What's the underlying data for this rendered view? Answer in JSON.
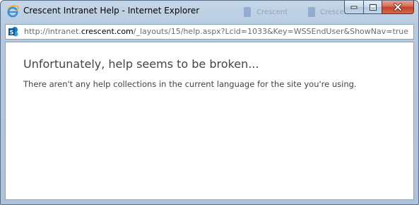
{
  "window": {
    "title": "Crescent Intranet Help - Internet Explorer",
    "background_items": [
      "Crescent Intranet",
      "Crescen"
    ]
  },
  "address_bar": {
    "url_prefix": "http://intranet.",
    "url_host": "crescent.com",
    "url_suffix": "/_layouts/15/help.aspx?Lcid=1033&Key=WSSEndUser&ShowNav=true",
    "site_icon": "sharepoint-icon"
  },
  "caption_buttons": [
    "minimize",
    "maximize",
    "close"
  ],
  "help": {
    "heading": "Unfortunately, help seems to be broken...",
    "message": "There aren't any help collections in the current language for the site you're using."
  },
  "colors": {
    "accent": "#0072c6",
    "close_button": "#c7432b",
    "frame": "#b5c9df"
  }
}
